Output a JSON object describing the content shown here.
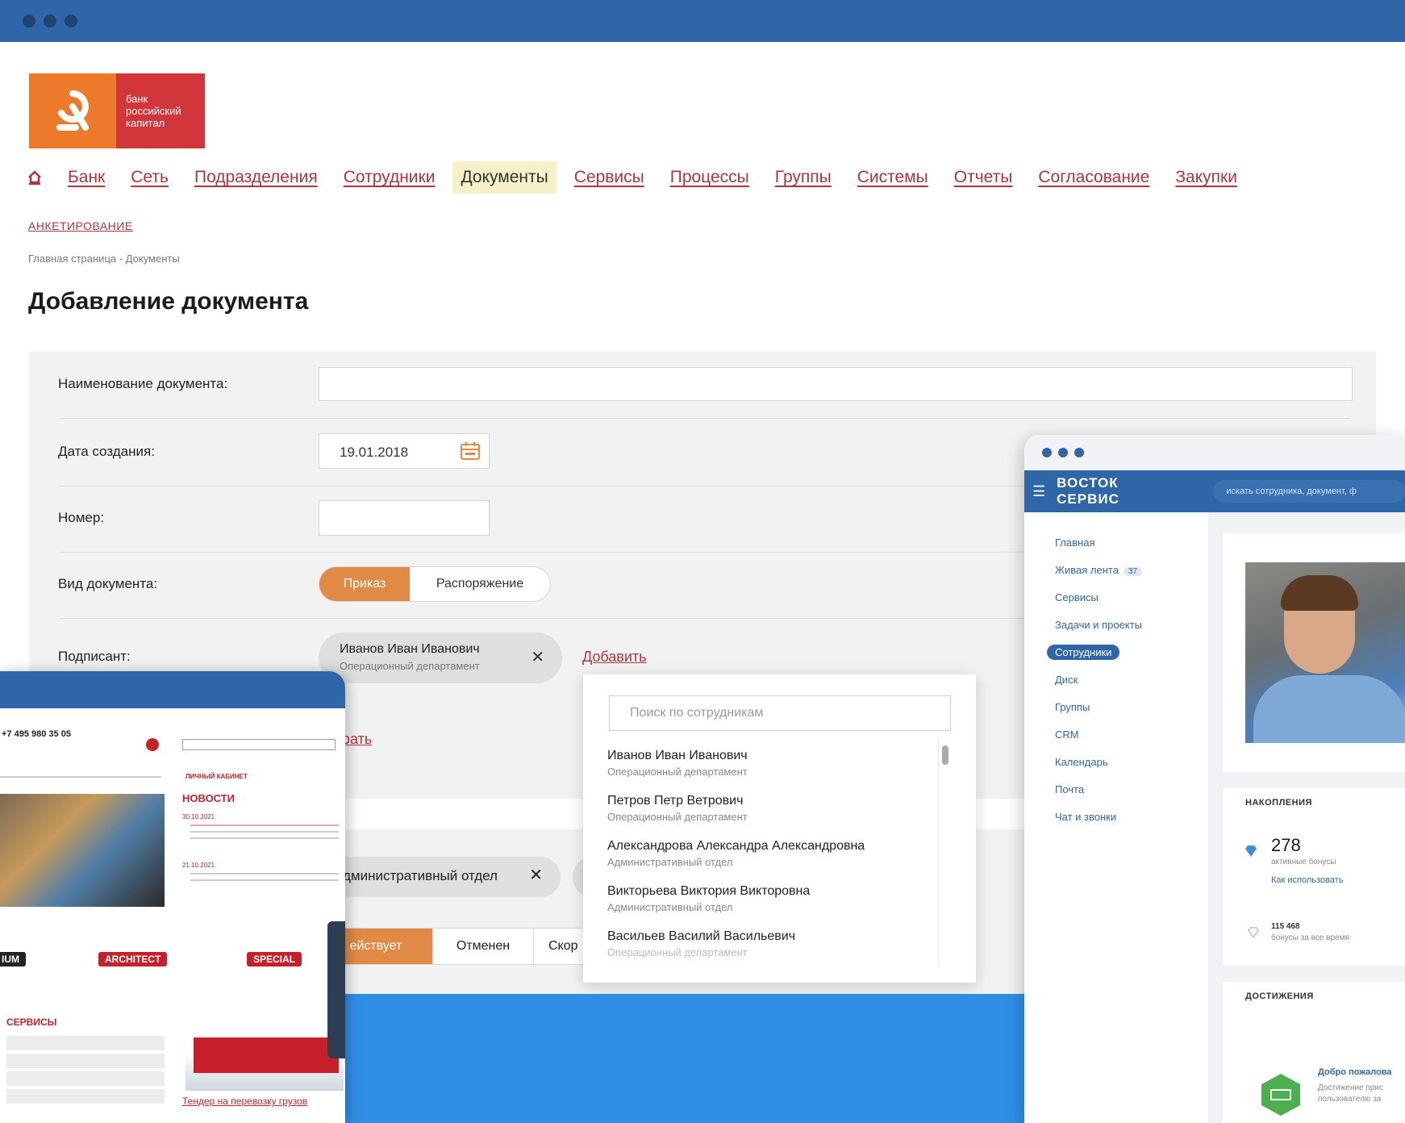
{
  "main": {
    "logo": {
      "line1": "банк",
      "line2": "российский",
      "line3": "капитал"
    },
    "nav": [
      {
        "label": "Банк"
      },
      {
        "label": "Сеть"
      },
      {
        "label": "Подразделения"
      },
      {
        "label": "Сотрудники"
      },
      {
        "label": "Документы",
        "active": true
      },
      {
        "label": "Сервисы"
      },
      {
        "label": "Процессы"
      },
      {
        "label": "Группы"
      },
      {
        "label": "Системы"
      },
      {
        "label": "Отчеты"
      },
      {
        "label": "Согласование"
      },
      {
        "label": "Закупки"
      }
    ],
    "subnav": "АНКЕТИРОВАНИЕ",
    "breadcrumb": "Главная страница - Документы",
    "title": "Добавление документа",
    "form": {
      "name_label": "Наименование документа:",
      "date_label": "Дата создания:",
      "date_value": "19.01.2018",
      "number_label": "Номер:",
      "type_label": "Вид документа:",
      "type_options": [
        "Приказ",
        "Распоряжение"
      ],
      "signer_label": "Подписант:",
      "signer_name": "Иванов Иван Иванович",
      "signer_dept": "Операционный департамент",
      "add_link": "Добавить",
      "partial_link": "рать",
      "dept_chip": "дминистративный отдел",
      "status_options": [
        "ействует",
        "Отменен",
        "Скор"
      ]
    },
    "dropdown": {
      "placeholder": "Поиск по сотрудникам",
      "items": [
        {
          "name": "Иванов Иван Иванович",
          "dept": "Операционный департамент"
        },
        {
          "name": "Петров Петр Ветрович",
          "dept": "Операционный департамент"
        },
        {
          "name": "Александрова Александра Александровна",
          "dept": "Административный отдел"
        },
        {
          "name": "Викторьева Виктория Викторовна",
          "dept": "Административный отдел"
        },
        {
          "name": "Васильев Василий Васильевич",
          "dept": "Операционный департамент"
        }
      ]
    }
  },
  "right_window": {
    "logo": "ВОСТОК СЕРВИС",
    "search_placeholder": "искать сотрудника, документ, ф",
    "sidebar": [
      {
        "label": "Главная"
      },
      {
        "label": "Живая лента",
        "badge": "37"
      },
      {
        "label": "Сервисы"
      },
      {
        "label": "Задачи и проекты"
      },
      {
        "label": "Сотрудники",
        "active": true
      },
      {
        "label": "Диск"
      },
      {
        "label": "Группы"
      },
      {
        "label": "CRM"
      },
      {
        "label": "Календарь"
      },
      {
        "label": "Почта"
      },
      {
        "label": "Чат и звонки"
      }
    ],
    "savings_title": "НАКОПЛЕНИЯ",
    "bonus_value": "278",
    "bonus_caption": "активные бонусы",
    "bonus_link": "Как использовать",
    "total_value": "115 468",
    "total_caption": "бонусы за все время",
    "achievements_title": "ДОСТИЖЕНИЯ",
    "welcome": "Добро пожалова",
    "welcome_sub1": "Достижение прис",
    "welcome_sub2": "пользователю за"
  },
  "left_window": {
    "phone": "+7 495 980 35 05",
    "news_title": "НОВОСТИ",
    "news_date1": "30.10.2021",
    "news_date2": "21.10.2021",
    "cabinet": "ЛИЧНЫЙ КАБИНЕТ",
    "tags": [
      "IUM",
      "ARCHITECT",
      "SPECIAL"
    ],
    "services_title": "СЕРВИСЫ",
    "truck_link": "Тендер на перевозку грузов"
  },
  "colors": {
    "brand_blue": "#2f66a8",
    "accent_orange": "#e08a46",
    "link_red": "#b0343a",
    "background": "#2f8fe6"
  }
}
